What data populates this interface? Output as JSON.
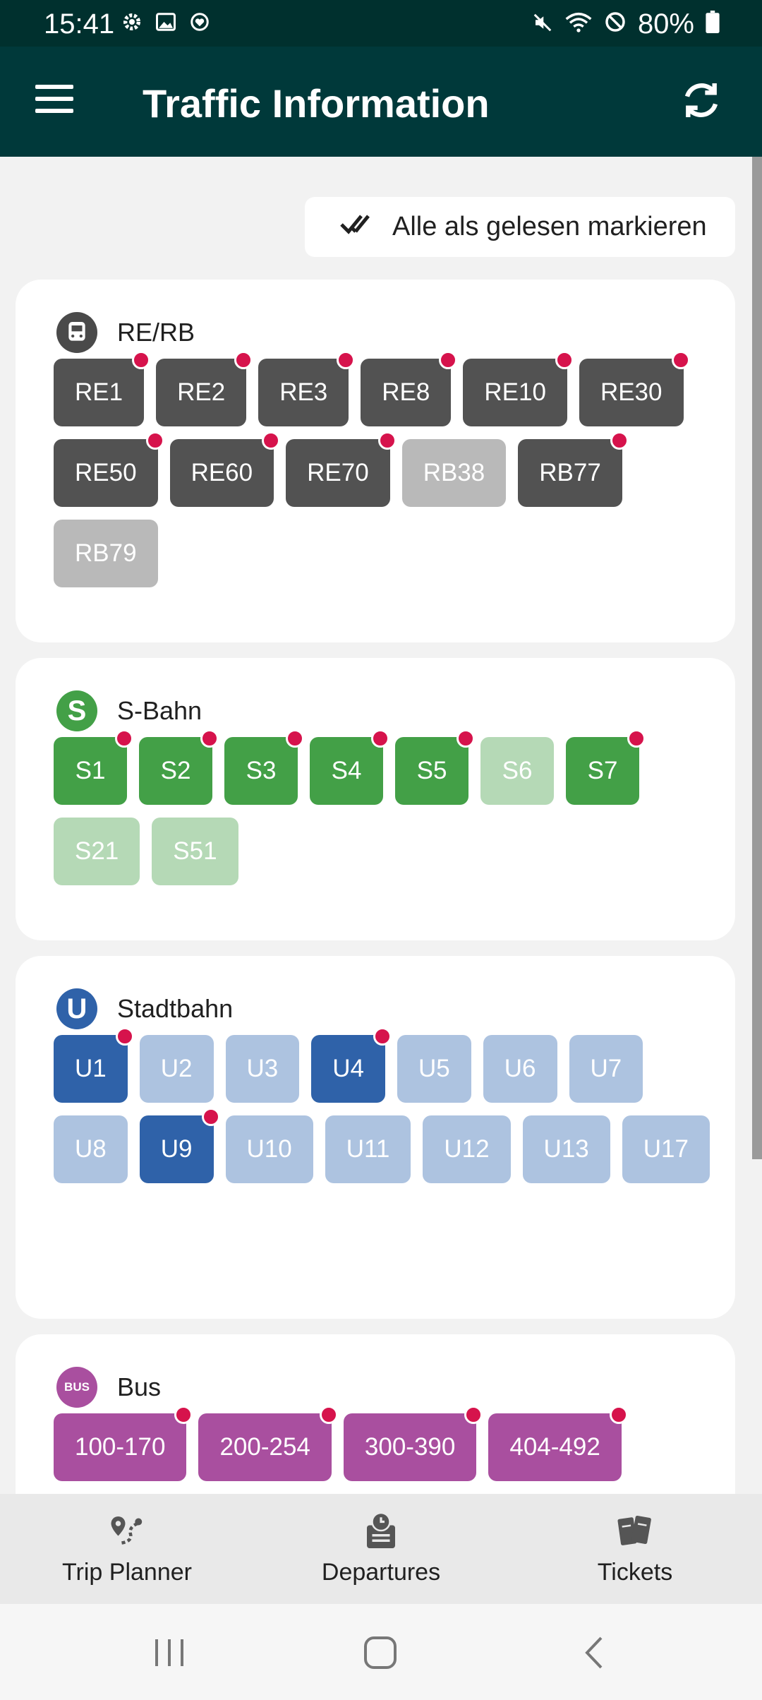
{
  "status_bar": {
    "time": "15:41",
    "battery": "80%",
    "icons": [
      "settings-icon",
      "image-icon",
      "heart-circle-icon",
      "mute-icon",
      "wifi-icon",
      "blocked-icon",
      "battery-icon"
    ]
  },
  "app_bar": {
    "title": "Traffic Information",
    "menu_icon": "hamburger-menu-icon",
    "refresh_icon": "refresh-icon"
  },
  "mark_read_button": {
    "label": "Alle als gelesen markieren",
    "icon": "double-check-icon"
  },
  "colors": {
    "header": "#00393a",
    "alert_dot": "#d6134c",
    "re": "#525252",
    "s_bahn": "#43a047",
    "stadtbahn": "#2f62a9",
    "bus": "#a94f9f"
  },
  "sections": [
    {
      "title": "RE/RB",
      "icon": "train-icon",
      "lines": [
        {
          "label": "RE1",
          "alert": true,
          "active": true
        },
        {
          "label": "RE2",
          "alert": true,
          "active": true
        },
        {
          "label": "RE3",
          "alert": true,
          "active": true
        },
        {
          "label": "RE8",
          "alert": true,
          "active": true
        },
        {
          "label": "RE10",
          "alert": true,
          "active": true
        },
        {
          "label": "RE30",
          "alert": true,
          "active": true
        },
        {
          "label": "RE50",
          "alert": true,
          "active": true
        },
        {
          "label": "RE60",
          "alert": true,
          "active": true
        },
        {
          "label": "RE70",
          "alert": true,
          "active": true
        },
        {
          "label": "RB38",
          "alert": false,
          "active": false
        },
        {
          "label": "RB77",
          "alert": true,
          "active": true
        },
        {
          "label": "RB79",
          "alert": false,
          "active": false
        }
      ]
    },
    {
      "title": "S-Bahn",
      "icon": "s-bahn-icon",
      "icon_text": "S",
      "lines": [
        {
          "label": "S1",
          "alert": true,
          "active": true
        },
        {
          "label": "S2",
          "alert": true,
          "active": true
        },
        {
          "label": "S3",
          "alert": true,
          "active": true
        },
        {
          "label": "S4",
          "alert": true,
          "active": true
        },
        {
          "label": "S5",
          "alert": true,
          "active": true
        },
        {
          "label": "S6",
          "alert": false,
          "active": false
        },
        {
          "label": "S7",
          "alert": true,
          "active": true
        },
        {
          "label": "S21",
          "alert": false,
          "active": false
        },
        {
          "label": "S51",
          "alert": false,
          "active": false
        }
      ]
    },
    {
      "title": "Stadtbahn",
      "icon": "u-bahn-icon",
      "icon_text": "U",
      "lines": [
        {
          "label": "U1",
          "alert": true,
          "active": true
        },
        {
          "label": "U2",
          "alert": false,
          "active": false
        },
        {
          "label": "U3",
          "alert": false,
          "active": false
        },
        {
          "label": "U4",
          "alert": true,
          "active": true
        },
        {
          "label": "U5",
          "alert": false,
          "active": false
        },
        {
          "label": "U6",
          "alert": false,
          "active": false
        },
        {
          "label": "U7",
          "alert": false,
          "active": false
        },
        {
          "label": "U8",
          "alert": false,
          "active": false
        },
        {
          "label": "U9",
          "alert": true,
          "active": true
        },
        {
          "label": "U10",
          "alert": false,
          "active": false
        },
        {
          "label": "U11",
          "alert": false,
          "active": false
        },
        {
          "label": "U12",
          "alert": false,
          "active": false
        },
        {
          "label": "U13",
          "alert": false,
          "active": false
        },
        {
          "label": "U17",
          "alert": false,
          "active": false
        }
      ]
    },
    {
      "title": "Bus",
      "icon": "bus-icon",
      "icon_text": "BUS",
      "lines": [
        {
          "label": "100-170",
          "alert": true,
          "active": true
        },
        {
          "label": "200-254",
          "alert": true,
          "active": true
        },
        {
          "label": "300-390",
          "alert": true,
          "active": true
        },
        {
          "label": "404-492",
          "alert": true,
          "active": true
        }
      ]
    }
  ],
  "bottom_nav": [
    {
      "label": "Trip Planner",
      "icon": "map-route-icon"
    },
    {
      "label": "Departures",
      "icon": "clock-board-icon"
    },
    {
      "label": "Tickets",
      "icon": "tickets-icon"
    }
  ],
  "system_nav": [
    "recents-icon",
    "home-icon",
    "back-icon"
  ]
}
